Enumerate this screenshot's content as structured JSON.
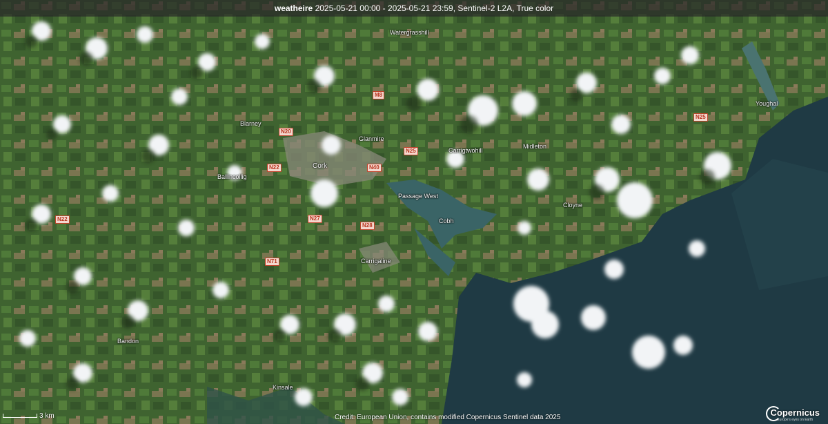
{
  "header": {
    "app": "weatheire",
    "info": "2025-05-21 00:00 - 2025-05-21 23:59, Sentinel-2 L2A, True color"
  },
  "places": [
    {
      "id": "watergrasshill",
      "label": "Watergrasshill"
    },
    {
      "id": "blarney",
      "label": "Blarney"
    },
    {
      "id": "glanmire",
      "label": "Glanmire"
    },
    {
      "id": "cork",
      "label": "Cork"
    },
    {
      "id": "carrigtwohill",
      "label": "Carrigtwohill"
    },
    {
      "id": "midleton",
      "label": "Midleton"
    },
    {
      "id": "youghal",
      "label": "Youghal"
    },
    {
      "id": "ballincollig",
      "label": "Ballincollig"
    },
    {
      "id": "passage-west",
      "label": "Passage West"
    },
    {
      "id": "cobh",
      "label": "Cobh"
    },
    {
      "id": "cloyne",
      "label": "Cloyne"
    },
    {
      "id": "carrigaline",
      "label": "Carrigaline"
    },
    {
      "id": "bandon",
      "label": "Bandon"
    },
    {
      "id": "kinsale",
      "label": "Kinsale"
    }
  ],
  "roads": [
    {
      "id": "m8",
      "label": "M8"
    },
    {
      "id": "n20",
      "label": "N20"
    },
    {
      "id": "n25-a",
      "label": "N25"
    },
    {
      "id": "n25-b",
      "label": "N25"
    },
    {
      "id": "n22-a",
      "label": "N22"
    },
    {
      "id": "n40",
      "label": "N40"
    },
    {
      "id": "n22-b",
      "label": "N22"
    },
    {
      "id": "n27",
      "label": "N27"
    },
    {
      "id": "n28",
      "label": "N28"
    },
    {
      "id": "n71",
      "label": "N71"
    }
  ],
  "scale": {
    "label": "3 km"
  },
  "credit": "Credit: European Union, contains modified Copernicus Sentinel data 2025",
  "logo": {
    "name": "Copernicus",
    "sub": "Europe's eyes on Earth"
  },
  "colors": {
    "land": "#3d5a2c",
    "sea": "#1f3a44",
    "cloud": "#f2f4f6",
    "header_bg": "rgba(40,40,40,0.72)",
    "road_fill": "#f4d8cf",
    "road_text": "#b8331d"
  }
}
